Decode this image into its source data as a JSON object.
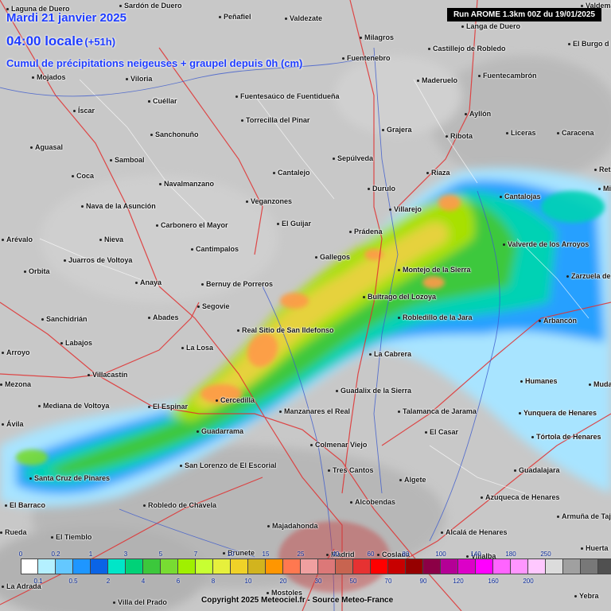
{
  "map": {
    "date_line": "Mardi 21 janvier 2025",
    "time_line": "04:00 locale",
    "time_offset": "(+51h)",
    "product_line": "Cumul de précipitations neigeuses + graupel depuis 0h (cm)",
    "run_label": "Run AROME 1.3km 00Z du 19/01/2025",
    "copyright": "Copyright 2025 Meteociel.fr - Source Meteo-France",
    "places": [
      "Laguna de Duero",
      "Sardón de Duero",
      "Valdezate",
      "Peñafiel",
      "Milagros",
      "Langa de Duero",
      "Valdema",
      "Castillejo de Robledo",
      "El Burgo d",
      "Fuentecambrón",
      "Fuentenebro",
      "Maderuelo",
      "Mojados",
      "Viloria",
      "Cuéllar",
      "Íscar",
      "Fuentesaúco de Fuentidueña",
      "Torrecilla del Pinar",
      "Grajera",
      "Ayllón",
      "Ribota",
      "Liceras",
      "Caracena",
      "Sanchonuño",
      "Aguasal",
      "Samboal",
      "Sepúlveda",
      "Coca",
      "Cantalejo",
      "Riaza",
      "Rete",
      "Navalmanzano",
      "Durulo",
      "Mie",
      "Cantalojas",
      "Nava de la Asunción",
      "Veganzones",
      "Villarejo",
      "Carbonero el Mayor",
      "El Guijar",
      "Prádena",
      "Arévalo",
      "Nieva",
      "Cantimpalos",
      "Valverde de los Arroyos",
      "Juarros de Voltoya",
      "Gallegos",
      "Orbita",
      "Montejo de la Sierra",
      "Zarzuela de",
      "Anaya",
      "Bernuy de Porreros",
      "Buitrago del Lozoya",
      "Segovie",
      "Sanchidrián",
      "Abades",
      "Robledillo de la Jara",
      "Arbancón",
      "Real Sitio de San Ildefonso",
      "Labajos",
      "La Losa",
      "La Cabrera",
      "Villacastín",
      "Humanes",
      "Muda",
      "Guadalix de la Sierra",
      "Cercedilla",
      "Mediana de Voltoya",
      "El Espinar",
      "Manzanares el Real",
      "Talamanca de Jarama",
      "Yunquera de Henares",
      "Guadarrama",
      "El Casar",
      "Tórtola de Henares",
      "Colmenar Viejo",
      "San Lorenzo de El Escorial",
      "Tres Cantos",
      "Guadalajara",
      "Algete",
      "Santa Cruz de Pinares",
      "El Barraco",
      "Alcobendas",
      "Azuqueca de Henares",
      "Robledo de Chavela",
      "Armuña de Tajuña",
      "Majadahonda",
      "Alcalá de Henares",
      "El Tiemblo",
      "Huerta",
      "Villalba",
      "Brunete",
      "Madrid",
      "Coslada",
      "Mostoles",
      "Villa del Prado",
      "Yebra",
      "Arroyo",
      "Ávila",
      "Mezona",
      "La Adrada",
      "Rueda",
      "Cuéllar"
    ]
  },
  "legend": {
    "colors": [
      "#ffffff",
      "#b4f0ff",
      "#64c8ff",
      "#1e96ff",
      "#0a64e6",
      "#00e6c8",
      "#00d278",
      "#3cc83c",
      "#78dc32",
      "#a0f000",
      "#c8ff32",
      "#e6f03c",
      "#f0d228",
      "#d2b41e",
      "#ff9600",
      "#ff7850",
      "#f0a0a0",
      "#dc7878",
      "#c86450",
      "#e63232",
      "#ff0000",
      "#c80000",
      "#960000",
      "#8c0046",
      "#b40096",
      "#dc00c8",
      "#ff00ff",
      "#ff64ff",
      "#ff96ff",
      "#ffc8ff",
      "#dcdcdc",
      "#a0a0a0",
      "#787878",
      "#505050",
      "#323232"
    ],
    "top_labels": [
      "0",
      "0.2",
      "1",
      "3",
      "5",
      "7",
      "10",
      "15",
      "25",
      "40",
      "60",
      "80",
      "100",
      "140",
      "180",
      "250"
    ],
    "bottom_labels": [
      "0.1",
      "0.5",
      "2",
      "4",
      "6",
      "8",
      "10",
      "20",
      "30",
      "50",
      "70",
      "90",
      "120",
      "160",
      "200"
    ]
  }
}
